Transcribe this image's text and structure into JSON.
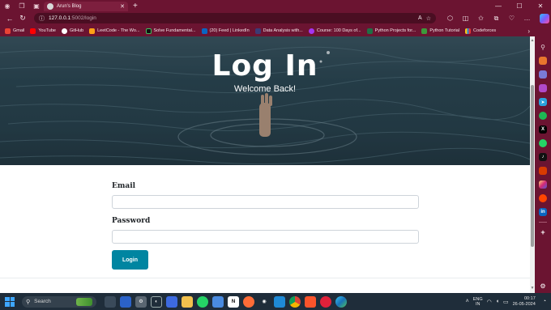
{
  "browser": {
    "tab_title": "Arun's Blog",
    "url_host": "127.0.0.1",
    "url_path": ":5002/login",
    "bookmarks": [
      {
        "label": "Gmail",
        "color": "#ea4335"
      },
      {
        "label": "YouTube",
        "color": "#ff0000"
      },
      {
        "label": "GitHub",
        "color": "#ffffff"
      },
      {
        "label": "LeetCode - The Wo...",
        "color": "#ffa116"
      },
      {
        "label": "Solve Fundamental...",
        "color": "#111111"
      },
      {
        "label": "(20) Feed | LinkedIn",
        "color": "#0a66c2"
      },
      {
        "label": "Data Analysis with...",
        "color": "#3b3b75"
      },
      {
        "label": "Course: 100 Days of...",
        "color": "#a435f0"
      },
      {
        "label": "Python Projects for...",
        "color": "#1f6f45"
      },
      {
        "label": "Python Tutorial",
        "color": "#3c9a3c"
      },
      {
        "label": "Codeforces",
        "color": "#e8e8e8"
      }
    ]
  },
  "hero": {
    "title": "Log In",
    "subtitle": "Welcome Back!"
  },
  "form": {
    "email_label": "Email",
    "email_value": "",
    "password_label": "Password",
    "password_value": "",
    "submit_label": "Login"
  },
  "colors": {
    "browser_frame": "#6b1431",
    "button": "#0085a1"
  },
  "taskbar": {
    "search_placeholder": "Search",
    "lang_top": "ENG",
    "lang_bottom": "IN",
    "time": "00:17",
    "date": "26-05-2024"
  }
}
